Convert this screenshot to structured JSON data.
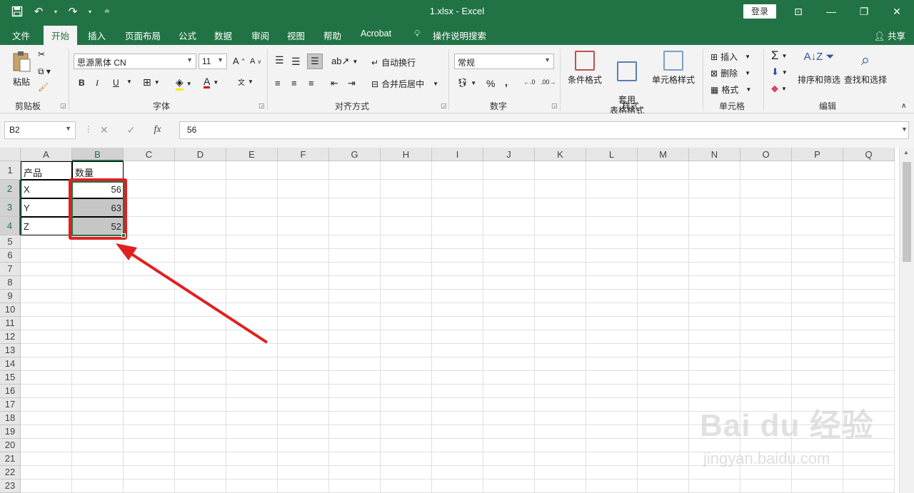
{
  "window": {
    "title": "1.xlsx  -  Excel",
    "login_label": "登录",
    "share_label": "共享"
  },
  "tabs": [
    "文件",
    "开始",
    "插入",
    "页面布局",
    "公式",
    "数据",
    "审阅",
    "视图",
    "帮助",
    "Acrobat",
    "操作说明搜索"
  ],
  "ribbon": {
    "clipboard": {
      "paste": "粘贴",
      "group": "剪贴板"
    },
    "font": {
      "name": "思源黑体 CN",
      "size": "11",
      "bold": "B",
      "italic": "I",
      "underline": "U",
      "group": "字体"
    },
    "alignment": {
      "wrap": "自动换行",
      "merge": "合并后居中",
      "group": "对齐方式"
    },
    "number": {
      "format": "常规",
      "percent": "%",
      "comma": ",",
      "group": "数字"
    },
    "styles": {
      "conditional": "条件格式",
      "table": "套用\n表格格式",
      "cell": "单元格样式",
      "group": "样式"
    },
    "cells": {
      "insert": "插入",
      "delete": "删除",
      "format": "格式",
      "group": "单元格"
    },
    "editing": {
      "sort": "排序和筛选",
      "find": "查找和选择",
      "group": "编辑"
    }
  },
  "formula_bar": {
    "cell_ref": "B2",
    "value": "56",
    "fx": "fx"
  },
  "columns": [
    "A",
    "B",
    "C",
    "D",
    "E",
    "F",
    "G",
    "H",
    "I",
    "J",
    "K",
    "L",
    "M",
    "N",
    "O",
    "P",
    "Q"
  ],
  "rows": [
    "1",
    "2",
    "3",
    "4",
    "5",
    "6",
    "7",
    "8",
    "9",
    "10",
    "11",
    "12",
    "13",
    "14",
    "15",
    "16",
    "17",
    "18",
    "19",
    "20",
    "21",
    "22",
    "23"
  ],
  "cells": {
    "A1": "产品",
    "B1": "数量",
    "A2": "X",
    "B2": "56",
    "A3": "Y",
    "B3": "63",
    "A4": "Z",
    "B4": "52"
  },
  "watermark": {
    "main": "Bai  du 经验",
    "sub": "jingyan.baidu.com"
  },
  "colors": {
    "accent": "#217346",
    "highlight_box": "#e02020",
    "selection": "#c6c6c6"
  }
}
